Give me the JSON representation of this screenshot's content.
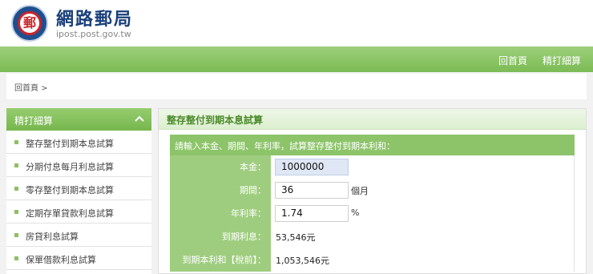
{
  "header": {
    "title": "網路郵局",
    "url": "ipost.post.gov.tw",
    "logo_glyph": "郵"
  },
  "nav": {
    "home": "回首頁",
    "favorites": "精打細算"
  },
  "breadcrumb": "回首頁 >",
  "sidebar": {
    "title": "精打細算",
    "items": [
      {
        "label": "整存整付到期本息試算"
      },
      {
        "label": "分期付息每月利息試算"
      },
      {
        "label": "零存整付到期本息試算"
      },
      {
        "label": "定期存單貸款利息試算"
      },
      {
        "label": "房貸利息試算"
      },
      {
        "label": "保單借款利息試算"
      }
    ]
  },
  "panel": {
    "title": "整存整付到期本息試算",
    "instruction": "請輸入本金、期間、年利率，試算整存整付到期本利和：",
    "principal_label": "本金：",
    "principal_value": "1000000",
    "period_label": "期間：",
    "period_value": "36",
    "period_unit": "個月",
    "rate_label": "年利率：",
    "rate_value": "1.74",
    "rate_unit": "%",
    "interest_label": "到期利息：",
    "interest_value": "53,546元",
    "total_label": "到期本利和【稅前】：",
    "total_value": "1,053,546元"
  },
  "colors": {
    "brand_green": "#8dc46a",
    "brand_blue": "#1a3f7a",
    "logo_red": "#c9242b"
  }
}
